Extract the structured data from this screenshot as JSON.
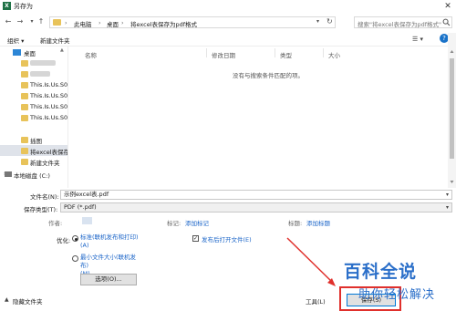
{
  "window": {
    "title": "另存为",
    "app_icon": "X",
    "close_glyph": "✕"
  },
  "nav": {
    "back": "←",
    "forward": "→",
    "up": "↑",
    "breadcrumb": [
      "此电脑",
      "桌面",
      "将excel表保存为pdf格式"
    ],
    "separator": "›",
    "search_placeholder": "搜索\"将excel表保存为pdf格式\""
  },
  "toolbar": {
    "organize": "组织 ▾",
    "new_folder": "新建文件夹",
    "view": "☰ ▾",
    "help": "?"
  },
  "sidebar": {
    "items": [
      {
        "label": "桌面",
        "type": "desktop",
        "selected": false
      },
      {
        "label": "",
        "type": "blurred"
      },
      {
        "label": "",
        "type": "blurred"
      },
      {
        "label": "This.Is.Us.S03",
        "type": "folder"
      },
      {
        "label": "This.Is.Us.S03",
        "type": "folder"
      },
      {
        "label": "This.Is.Us.S03",
        "type": "folder"
      },
      {
        "label": "This.Is.Us.S03",
        "type": "folder"
      },
      {
        "label": "插图",
        "type": "folder"
      },
      {
        "label": "将excel表保存",
        "type": "folder",
        "selected": true
      },
      {
        "label": "新建文件夹",
        "type": "folder"
      },
      {
        "label": "本地磁盘 (C:)",
        "type": "drive"
      }
    ]
  },
  "filelist": {
    "columns": [
      "名称",
      "修改日期",
      "类型",
      "大小"
    ],
    "empty_message": "没有与搜索条件匹配的项。"
  },
  "form": {
    "filename_label": "文件名(N):",
    "filename_value": "示例excel表.pdf",
    "type_label": "保存类型(T):",
    "type_value": "PDF (*.pdf)",
    "author_label": "作者:",
    "tags_label": "标记:",
    "tags_value": "添加标记",
    "title_label": "标题:",
    "title_value": "添加标题",
    "optimize_label": "优化:",
    "opt_standard": "标准(联机发布和打印)",
    "opt_standard_key": "(A)",
    "opt_min": "最小文件大小(联机发布)",
    "opt_min_key": "(M)",
    "open_after_label": "发布后打开文件(E)",
    "options_button": "选项(O)...",
    "hide_folders": "隐藏文件夹",
    "tools_label": "工具(L)",
    "save_button": "保存(S)"
  },
  "watermark": {
    "main": "百科全说",
    "sub": "助你轻松解决"
  },
  "colors": {
    "link": "#1a64c8",
    "folder": "#e8c35a",
    "excel": "#1e7145",
    "highlight": "#e0302c",
    "watermark": "#2b6fc9"
  }
}
